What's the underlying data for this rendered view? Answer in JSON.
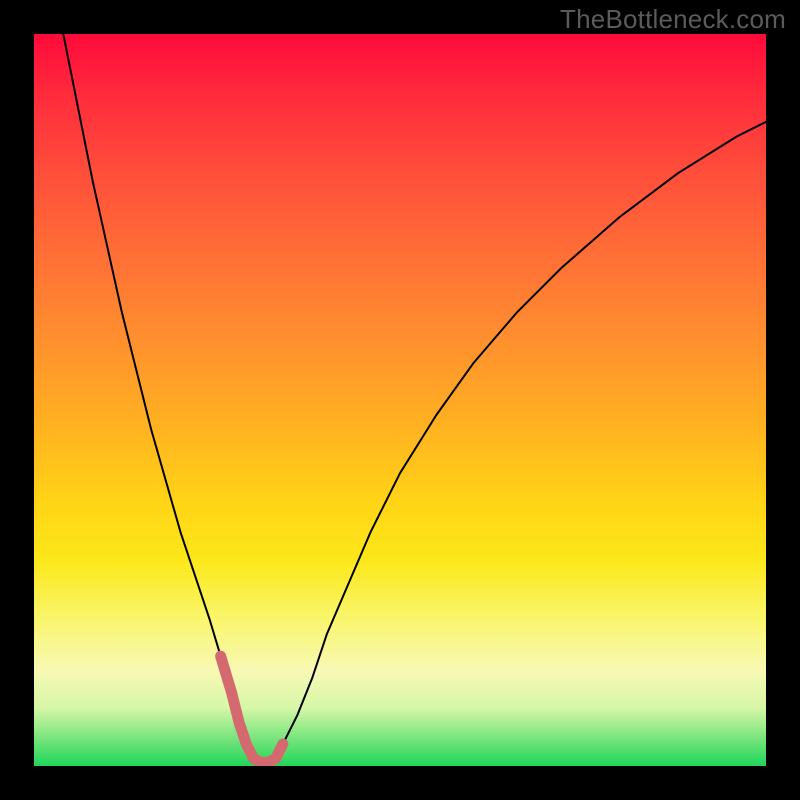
{
  "watermark": "TheBottleneck.com",
  "chart_data": {
    "type": "line",
    "title": "",
    "xlabel": "",
    "ylabel": "",
    "xlim": [
      0,
      100
    ],
    "ylim": [
      0,
      100
    ],
    "background_gradient": {
      "direction": "vertical",
      "stops": [
        {
          "pos": 0,
          "color": "#ff0a3a"
        },
        {
          "pos": 18,
          "color": "#ff4b3b"
        },
        {
          "pos": 42,
          "color": "#ff902e"
        },
        {
          "pos": 64,
          "color": "#ffd416"
        },
        {
          "pos": 80,
          "color": "#f9f66d"
        },
        {
          "pos": 92,
          "color": "#d7f7a8"
        },
        {
          "pos": 100,
          "color": "#1fd65a"
        }
      ]
    },
    "series": [
      {
        "name": "curve",
        "stroke": "#000000",
        "stroke_width": 2,
        "x": [
          4,
          6,
          8,
          10,
          12,
          14,
          16,
          18,
          20,
          22,
          24,
          25.5,
          27,
          28,
          29,
          30,
          31,
          32,
          33,
          34,
          36,
          38,
          40,
          43,
          46,
          50,
          55,
          60,
          66,
          72,
          80,
          88,
          96,
          100
        ],
        "y": [
          100,
          90,
          80,
          71,
          62,
          54,
          46,
          39,
          32,
          26,
          20,
          15,
          10,
          6,
          3,
          1,
          0.5,
          0.5,
          1,
          3,
          7,
          12,
          18,
          25,
          32,
          40,
          48,
          55,
          62,
          68,
          75,
          81,
          86,
          88
        ]
      },
      {
        "name": "highlight-band",
        "stroke": "#d46a6f",
        "stroke_width": 11,
        "x": [
          25.5,
          27,
          28,
          29,
          30,
          31,
          32,
          33,
          34
        ],
        "y": [
          15,
          10,
          6,
          3,
          1,
          0.5,
          0.5,
          1,
          3
        ]
      }
    ]
  }
}
